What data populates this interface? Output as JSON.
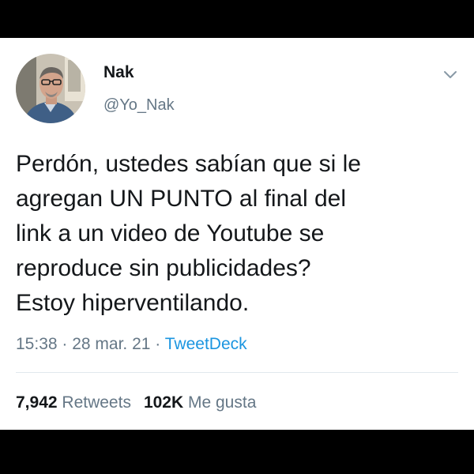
{
  "user": {
    "name": "Nak",
    "handle": "@Yo_Nak"
  },
  "tweet": {
    "lines": [
      "Perdón, ustedes sabían que si le",
      "agregan UN PUNTO al final del",
      "link a un video de Youtube se",
      "reproduce sin publicidades?",
      "Estoy hiperventilando."
    ],
    "time": "15:38",
    "separator": " · ",
    "date": "28 mar. 21",
    "source": "TweetDeck"
  },
  "stats": {
    "retweets_count": "7,942",
    "retweets_label": "Retweets",
    "likes_count": "102K",
    "likes_label": "Me gusta"
  },
  "icons": {
    "menu": "chevron-down-icon"
  },
  "colors": {
    "text": "#14171a",
    "secondary": "#657786",
    "link": "#1b95e0",
    "border": "#e1e8ed"
  }
}
